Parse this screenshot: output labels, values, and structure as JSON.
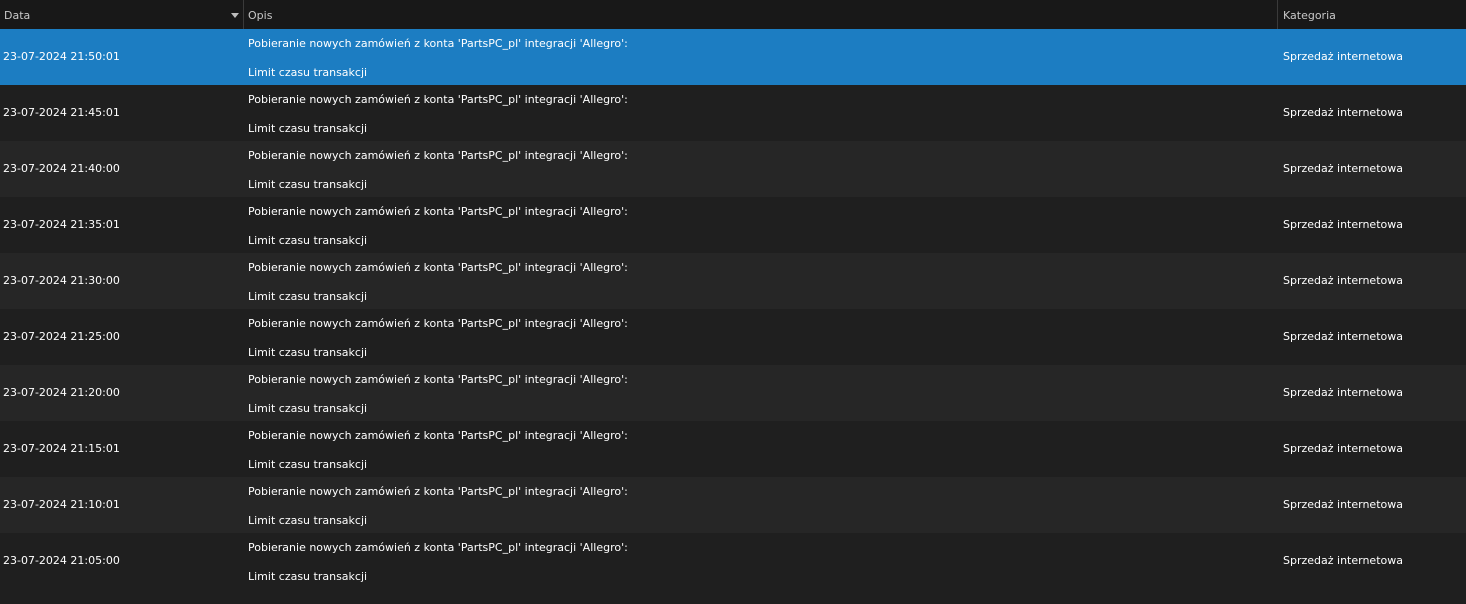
{
  "table": {
    "columns": {
      "date": "Data",
      "description": "Opis",
      "category": "Kategoria"
    },
    "sort_indicator": "sort-descending-icon",
    "colors": {
      "header_bg": "#181818",
      "row_bg": "#1f1f1f",
      "row_alt_bg": "#262626",
      "selected_bg": "#1c7dc2"
    },
    "rows": [
      {
        "date": "23-07-2024 21:50:01",
        "line1": "Pobieranie nowych zamówień z konta 'PartsPC_pl' integracji 'Allegro':",
        "line2": "Limit czasu transakcji",
        "category": "Sprzedaż internetowa",
        "selected": true
      },
      {
        "date": "23-07-2024 21:45:01",
        "line1": "Pobieranie nowych zamówień z konta 'PartsPC_pl' integracji 'Allegro':",
        "line2": "Limit czasu transakcji",
        "category": "Sprzedaż internetowa",
        "selected": false
      },
      {
        "date": "23-07-2024 21:40:00",
        "line1": "Pobieranie nowych zamówień z konta 'PartsPC_pl' integracji 'Allegro':",
        "line2": "Limit czasu transakcji",
        "category": "Sprzedaż internetowa",
        "selected": false
      },
      {
        "date": "23-07-2024 21:35:01",
        "line1": "Pobieranie nowych zamówień z konta 'PartsPC_pl' integracji 'Allegro':",
        "line2": "Limit czasu transakcji",
        "category": "Sprzedaż internetowa",
        "selected": false
      },
      {
        "date": "23-07-2024 21:30:00",
        "line1": "Pobieranie nowych zamówień z konta 'PartsPC_pl' integracji 'Allegro':",
        "line2": "Limit czasu transakcji",
        "category": "Sprzedaż internetowa",
        "selected": false
      },
      {
        "date": "23-07-2024 21:25:00",
        "line1": "Pobieranie nowych zamówień z konta 'PartsPC_pl' integracji 'Allegro':",
        "line2": "Limit czasu transakcji",
        "category": "Sprzedaż internetowa",
        "selected": false
      },
      {
        "date": "23-07-2024 21:20:00",
        "line1": "Pobieranie nowych zamówień z konta 'PartsPC_pl' integracji 'Allegro':",
        "line2": "Limit czasu transakcji",
        "category": "Sprzedaż internetowa",
        "selected": false
      },
      {
        "date": "23-07-2024 21:15:01",
        "line1": "Pobieranie nowych zamówień z konta 'PartsPC_pl' integracji 'Allegro':",
        "line2": "Limit czasu transakcji",
        "category": "Sprzedaż internetowa",
        "selected": false
      },
      {
        "date": "23-07-2024 21:10:01",
        "line1": "Pobieranie nowych zamówień z konta 'PartsPC_pl' integracji 'Allegro':",
        "line2": "Limit czasu transakcji",
        "category": "Sprzedaż internetowa",
        "selected": false
      },
      {
        "date": "23-07-2024 21:05:00",
        "line1": "Pobieranie nowych zamówień z konta 'PartsPC_pl' integracji 'Allegro':",
        "line2": "Limit czasu transakcji",
        "category": "Sprzedaż internetowa",
        "selected": false
      }
    ]
  }
}
